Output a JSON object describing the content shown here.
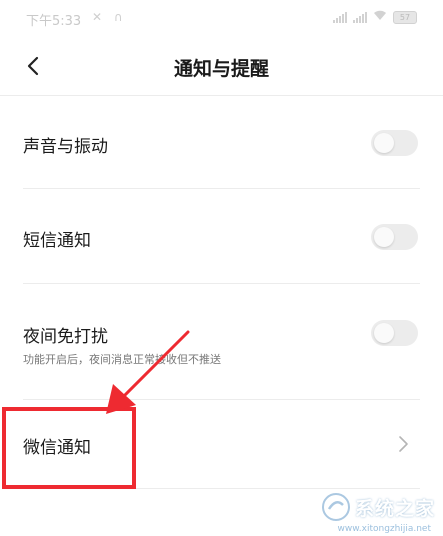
{
  "status_bar": {
    "time": "下午5:33",
    "left_icons": "✕ ∩",
    "battery": "57"
  },
  "header": {
    "title": "通知与提醒"
  },
  "settings": [
    {
      "label": "声音与振动",
      "enabled": false
    },
    {
      "label": "短信通知",
      "enabled": false
    },
    {
      "label": "夜间免打扰",
      "subtitle": "功能开启后，夜间消息正常接收但不推送",
      "enabled": false
    },
    {
      "label": "微信通知"
    }
  ],
  "watermark": {
    "text": "系统之家",
    "url": "www.xitongzhijia.net"
  },
  "colors": {
    "highlight": "#ee2a31",
    "toggle_off": "#ececec"
  }
}
